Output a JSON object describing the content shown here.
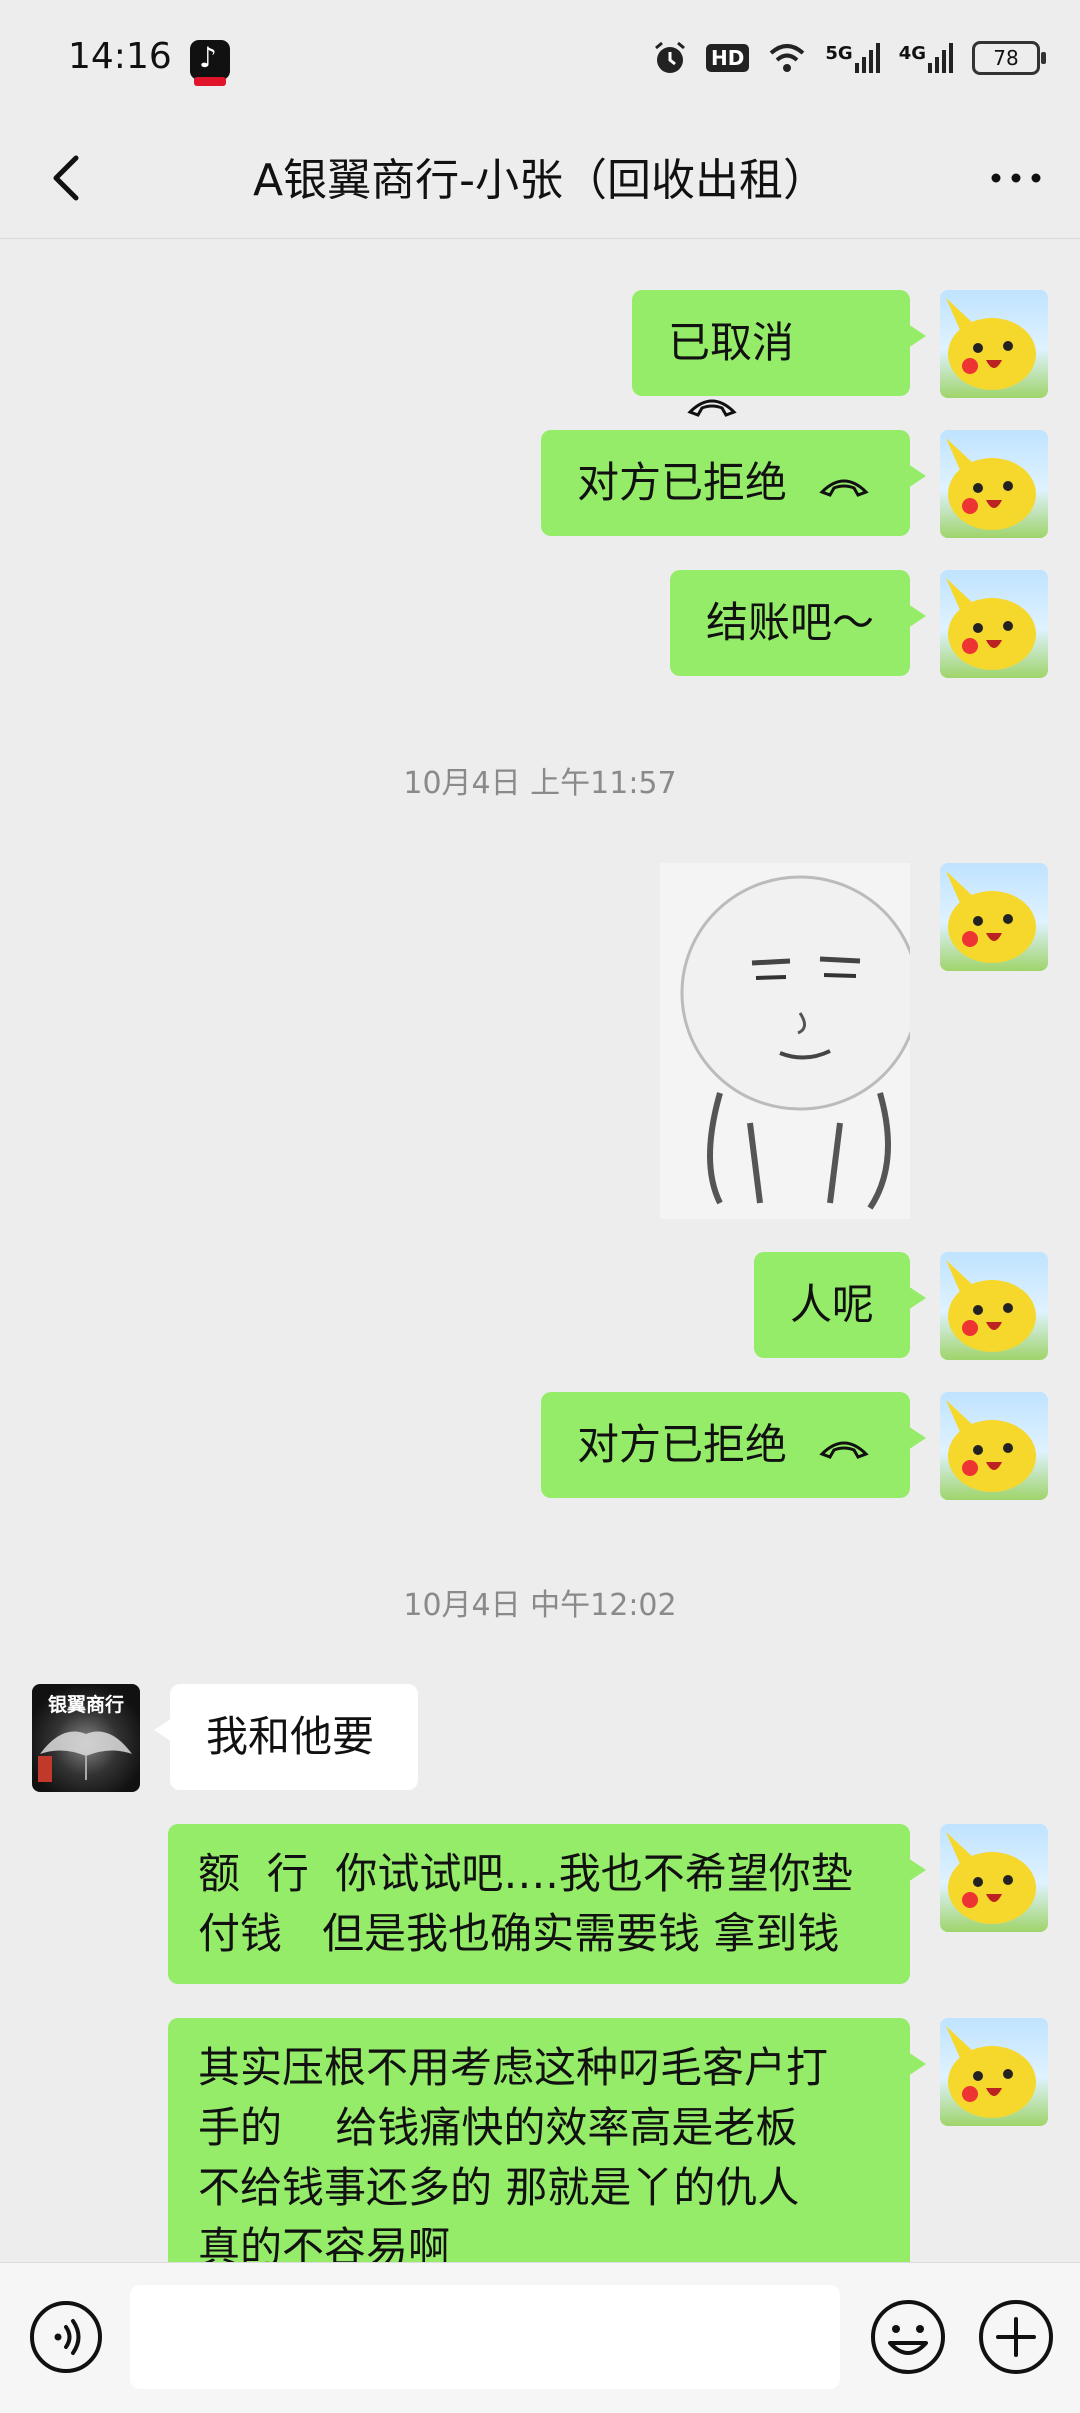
{
  "status_bar": {
    "time": "14:16",
    "icons": [
      "app-icon",
      "alarm-icon",
      "hd-icon",
      "wifi-icon",
      "5g-signal-icon",
      "4g-signal-icon"
    ],
    "hd_label": "HD",
    "net_5g": "5G",
    "net_4g": "4G",
    "battery": "78"
  },
  "header": {
    "title": "A银翼商行-小张（回收出租）"
  },
  "avatar_other_text": "银翼商行",
  "messages": [
    {
      "from": "me",
      "text": "已取消",
      "call_icon": true
    },
    {
      "from": "me",
      "text": "对方已拒绝",
      "call_icon": true
    },
    {
      "from": "me",
      "text": "结账吧～"
    },
    {
      "type": "time",
      "text": "10月4日 上午11:57"
    },
    {
      "from": "me",
      "type": "sticker"
    },
    {
      "from": "me",
      "text": "人呢"
    },
    {
      "from": "me",
      "text": "对方已拒绝",
      "call_icon": true
    },
    {
      "type": "time",
      "text": "10月4日 中午12:02"
    },
    {
      "from": "other",
      "text": "我和他要"
    },
    {
      "from": "me",
      "lines": [
        "额  行  你试试吧….我也不希望你垫",
        "付钱   但是我也确实需要钱 拿到钱"
      ]
    },
    {
      "from": "me",
      "lines": [
        "其实压根不用考虑这种叼毛客户打",
        "手的    给钱痛快的效率高是老板",
        "不给钱事还多的 那就是丫的仇人",
        "真的不容易啊"
      ]
    }
  ],
  "input_bar": {
    "placeholder": ""
  },
  "colors": {
    "background": "#ededed",
    "outgoing_bubble": "#95ec69",
    "incoming_bubble": "#ffffff"
  }
}
